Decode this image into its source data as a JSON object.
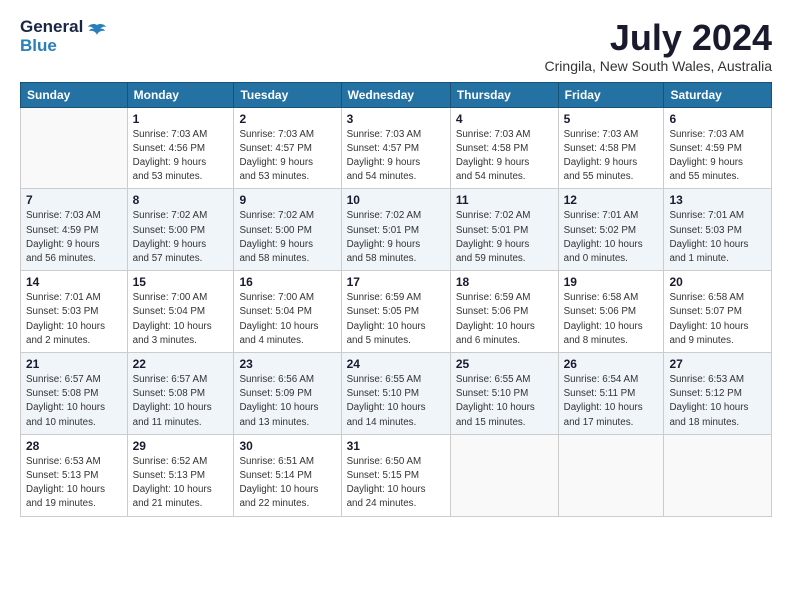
{
  "logo": {
    "line1": "General",
    "line2": "Blue"
  },
  "title": "July 2024",
  "subtitle": "Cringila, New South Wales, Australia",
  "days_of_week": [
    "Sunday",
    "Monday",
    "Tuesday",
    "Wednesday",
    "Thursday",
    "Friday",
    "Saturday"
  ],
  "weeks": [
    [
      {
        "day": "",
        "info": ""
      },
      {
        "day": "1",
        "info": "Sunrise: 7:03 AM\nSunset: 4:56 PM\nDaylight: 9 hours\nand 53 minutes."
      },
      {
        "day": "2",
        "info": "Sunrise: 7:03 AM\nSunset: 4:57 PM\nDaylight: 9 hours\nand 53 minutes."
      },
      {
        "day": "3",
        "info": "Sunrise: 7:03 AM\nSunset: 4:57 PM\nDaylight: 9 hours\nand 54 minutes."
      },
      {
        "day": "4",
        "info": "Sunrise: 7:03 AM\nSunset: 4:58 PM\nDaylight: 9 hours\nand 54 minutes."
      },
      {
        "day": "5",
        "info": "Sunrise: 7:03 AM\nSunset: 4:58 PM\nDaylight: 9 hours\nand 55 minutes."
      },
      {
        "day": "6",
        "info": "Sunrise: 7:03 AM\nSunset: 4:59 PM\nDaylight: 9 hours\nand 55 minutes."
      }
    ],
    [
      {
        "day": "7",
        "info": "Sunrise: 7:03 AM\nSunset: 4:59 PM\nDaylight: 9 hours\nand 56 minutes."
      },
      {
        "day": "8",
        "info": "Sunrise: 7:02 AM\nSunset: 5:00 PM\nDaylight: 9 hours\nand 57 minutes."
      },
      {
        "day": "9",
        "info": "Sunrise: 7:02 AM\nSunset: 5:00 PM\nDaylight: 9 hours\nand 58 minutes."
      },
      {
        "day": "10",
        "info": "Sunrise: 7:02 AM\nSunset: 5:01 PM\nDaylight: 9 hours\nand 58 minutes."
      },
      {
        "day": "11",
        "info": "Sunrise: 7:02 AM\nSunset: 5:01 PM\nDaylight: 9 hours\nand 59 minutes."
      },
      {
        "day": "12",
        "info": "Sunrise: 7:01 AM\nSunset: 5:02 PM\nDaylight: 10 hours\nand 0 minutes."
      },
      {
        "day": "13",
        "info": "Sunrise: 7:01 AM\nSunset: 5:03 PM\nDaylight: 10 hours\nand 1 minute."
      }
    ],
    [
      {
        "day": "14",
        "info": "Sunrise: 7:01 AM\nSunset: 5:03 PM\nDaylight: 10 hours\nand 2 minutes."
      },
      {
        "day": "15",
        "info": "Sunrise: 7:00 AM\nSunset: 5:04 PM\nDaylight: 10 hours\nand 3 minutes."
      },
      {
        "day": "16",
        "info": "Sunrise: 7:00 AM\nSunset: 5:04 PM\nDaylight: 10 hours\nand 4 minutes."
      },
      {
        "day": "17",
        "info": "Sunrise: 6:59 AM\nSunset: 5:05 PM\nDaylight: 10 hours\nand 5 minutes."
      },
      {
        "day": "18",
        "info": "Sunrise: 6:59 AM\nSunset: 5:06 PM\nDaylight: 10 hours\nand 6 minutes."
      },
      {
        "day": "19",
        "info": "Sunrise: 6:58 AM\nSunset: 5:06 PM\nDaylight: 10 hours\nand 8 minutes."
      },
      {
        "day": "20",
        "info": "Sunrise: 6:58 AM\nSunset: 5:07 PM\nDaylight: 10 hours\nand 9 minutes."
      }
    ],
    [
      {
        "day": "21",
        "info": "Sunrise: 6:57 AM\nSunset: 5:08 PM\nDaylight: 10 hours\nand 10 minutes."
      },
      {
        "day": "22",
        "info": "Sunrise: 6:57 AM\nSunset: 5:08 PM\nDaylight: 10 hours\nand 11 minutes."
      },
      {
        "day": "23",
        "info": "Sunrise: 6:56 AM\nSunset: 5:09 PM\nDaylight: 10 hours\nand 13 minutes."
      },
      {
        "day": "24",
        "info": "Sunrise: 6:55 AM\nSunset: 5:10 PM\nDaylight: 10 hours\nand 14 minutes."
      },
      {
        "day": "25",
        "info": "Sunrise: 6:55 AM\nSunset: 5:10 PM\nDaylight: 10 hours\nand 15 minutes."
      },
      {
        "day": "26",
        "info": "Sunrise: 6:54 AM\nSunset: 5:11 PM\nDaylight: 10 hours\nand 17 minutes."
      },
      {
        "day": "27",
        "info": "Sunrise: 6:53 AM\nSunset: 5:12 PM\nDaylight: 10 hours\nand 18 minutes."
      }
    ],
    [
      {
        "day": "28",
        "info": "Sunrise: 6:53 AM\nSunset: 5:13 PM\nDaylight: 10 hours\nand 19 minutes."
      },
      {
        "day": "29",
        "info": "Sunrise: 6:52 AM\nSunset: 5:13 PM\nDaylight: 10 hours\nand 21 minutes."
      },
      {
        "day": "30",
        "info": "Sunrise: 6:51 AM\nSunset: 5:14 PM\nDaylight: 10 hours\nand 22 minutes."
      },
      {
        "day": "31",
        "info": "Sunrise: 6:50 AM\nSunset: 5:15 PM\nDaylight: 10 hours\nand 24 minutes."
      },
      {
        "day": "",
        "info": ""
      },
      {
        "day": "",
        "info": ""
      },
      {
        "day": "",
        "info": ""
      }
    ]
  ]
}
